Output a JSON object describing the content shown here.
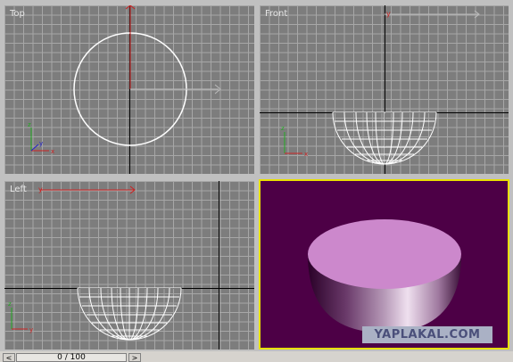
{
  "viewports": {
    "top": {
      "label": "Top"
    },
    "front": {
      "label": "Front"
    },
    "left": {
      "label": "Left"
    },
    "perspective": {
      "label": ""
    }
  },
  "axes": {
    "x": "x",
    "y": "y",
    "z": "z"
  },
  "timeline": {
    "frame_readout": "0 / 100",
    "prev_glyph": "<",
    "next_glyph": ">"
  },
  "watermark": {
    "text": "YAPLAKAL.COM"
  },
  "colors": {
    "grid_bg": "#7d7d7d",
    "grid_line": "#a7a7a7",
    "perspective_bg": "#4d0046",
    "bowl_rim": "#cc88cc",
    "active_border": "#e8e000",
    "x_axis": "#cc2222",
    "y_axis": "#22aa22",
    "z_axis": "#2222cc"
  }
}
